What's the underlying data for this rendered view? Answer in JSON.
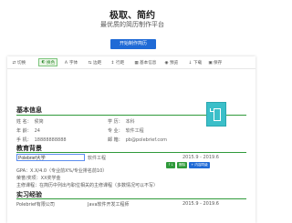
{
  "hero": {
    "title": "极取、简约",
    "subtitle": "最优质的简历制作平台",
    "cta": "开始制作简历"
  },
  "toolbar": {
    "items": [
      {
        "id": "switch",
        "icon": "swap-icon",
        "glyph": "⇄",
        "label": "切换"
      },
      {
        "id": "color",
        "icon": "palette-icon",
        "glyph": "◐",
        "label": "换色",
        "active": true
      },
      {
        "id": "font",
        "icon": "font-icon",
        "glyph": "A",
        "label": "字体"
      },
      {
        "id": "spacing",
        "icon": "spacing-icon",
        "glyph": "⇆",
        "label": "边距"
      },
      {
        "id": "spacing2",
        "icon": "line-height-icon",
        "glyph": "↕",
        "label": "行距"
      },
      {
        "id": "modules",
        "icon": "grid-icon",
        "glyph": "▦",
        "label": "基本信息"
      },
      {
        "id": "preview",
        "icon": "eye-icon",
        "glyph": "◉",
        "label": "预览"
      },
      {
        "id": "download",
        "icon": "download-icon",
        "glyph": "↓",
        "label": "下载"
      },
      {
        "id": "save",
        "icon": "save-icon",
        "glyph": "▣",
        "label": "保存"
      }
    ]
  },
  "basic": {
    "title": "基本信息",
    "name_label": "姓 名：",
    "name": "侯简",
    "edu_label": "学 历：",
    "edu": "本科",
    "age_label": "年 龄：",
    "age": "24",
    "major_label": "专 业：",
    "major": "软件工程",
    "phone_label": "手 机：",
    "phone": "18888888888",
    "email_label": "邮 箱：",
    "email": "pb@polebrief.com"
  },
  "education": {
    "title": "教育背景",
    "school": "Polebrief大学",
    "major": "软件工程",
    "period": "2015.9 - 2019.6",
    "gpa": "GPA：X.X/4.0（专业前X%/专业排名前10）",
    "honors": "荣誉/奖项：XX奖学金",
    "courses": "主修课程：在简历中列出与职位相关的主修课程（多数情况可以不写）"
  },
  "editor_tools": {
    "move": "↑↓",
    "delete": "删除",
    "insert": "+ 内容同级"
  },
  "internship": {
    "title": "实习经验",
    "company": "Polebrief有限公司",
    "role": "Java软件开发工程师",
    "period": "2015.9 - 2019.6"
  },
  "colors": {
    "accent": "#2f9a3a",
    "brand": "#1f6ad6"
  }
}
